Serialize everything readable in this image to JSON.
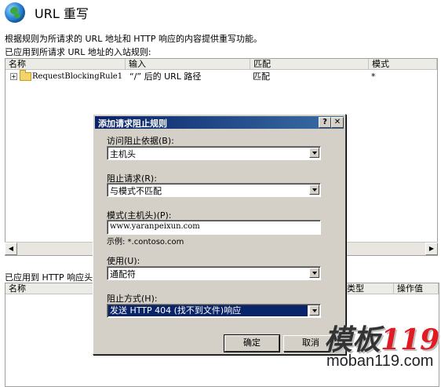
{
  "header": {
    "title": "URL 重写",
    "description": "根据规则为所请求的 URL 地址和 HTTP 响应的内容提供重写功能。",
    "inbound_section_label": "已应用到所请求 URL 地址的入站规则:"
  },
  "inbound_grid": {
    "columns": [
      "名称",
      "输入",
      "匹配",
      "模式"
    ],
    "rows": [
      {
        "expander": "+",
        "name": "RequestBlockingRule1",
        "input": "“/” 后的 URL 路径",
        "match": "匹配",
        "pattern": "*"
      }
    ]
  },
  "outbound_section_label": "已应用到 HTTP 响应头或",
  "outbound_grid": {
    "columns": [
      "名称",
      "类型",
      "操作值"
    ]
  },
  "dialog": {
    "title": "添加请求阻止规则",
    "help_label": "?",
    "close_label": "✕",
    "access_block_by_label": "访问阻止依据(B):",
    "access_block_by_value": "主机头",
    "block_request_label": "阻止请求(R):",
    "block_request_value": "与模式不匹配",
    "pattern_label": "模式(主机头)(P):",
    "pattern_value": "www.yaranpeixun.com",
    "example_text": "示例: *.contoso.com",
    "using_label": "使用(U):",
    "using_value": "通配符",
    "how_to_block_label": "阻止方式(H):",
    "how_to_block_value": "发送 HTTP 404 (找不到文件)响应",
    "ok_label": "确定",
    "cancel_label": "取消"
  },
  "watermark": {
    "logo_text": "模板",
    "logo_number": "119",
    "site": "moban119.com"
  }
}
